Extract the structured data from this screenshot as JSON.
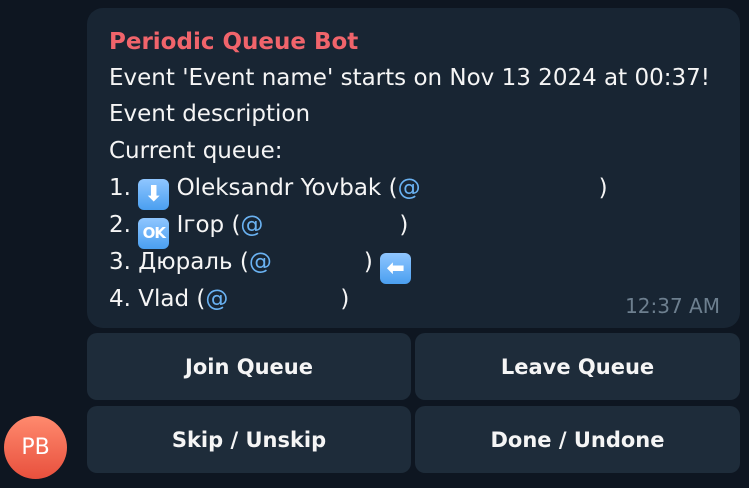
{
  "message": {
    "sender": "Periodic Queue Bot",
    "lines": [
      "Event 'Event name' starts on Nov 13 2024 at 00:37!",
      "Event description",
      "Current queue:"
    ],
    "queue": [
      {
        "number": "1.",
        "emoji": "⬇",
        "emoji_name": "arrow-down-emoji",
        "name": "Oleksandr Yovbak",
        "open": "(",
        "at": "@",
        "close": ")"
      },
      {
        "number": "2.",
        "emoji": "OK",
        "emoji_name": "ok-emoji",
        "name": "Ігор",
        "open": "(",
        "at": "@",
        "close": ")"
      },
      {
        "number": "3.",
        "name": "Дюраль",
        "open": "(",
        "at": "@",
        "close": ")",
        "trailing_emoji": "⬅",
        "trailing_emoji_name": "arrow-left-emoji"
      },
      {
        "number": "4.",
        "name": "Vlad",
        "open": "(",
        "at": "@",
        "close": ")"
      }
    ],
    "time": "12:37 AM"
  },
  "keyboard": {
    "buttons": [
      "Join Queue",
      "Leave Queue",
      "Skip / Unskip",
      "Done / Undone"
    ]
  },
  "avatar": {
    "initials": "PB"
  },
  "colors": {
    "background": "#0e1621",
    "bubble": "#182533",
    "sender": "#f0646b",
    "mention": "#6ab2f2",
    "time": "#6d7f8f",
    "button": "#1e2c3a",
    "avatar": "#ed6a4f"
  }
}
